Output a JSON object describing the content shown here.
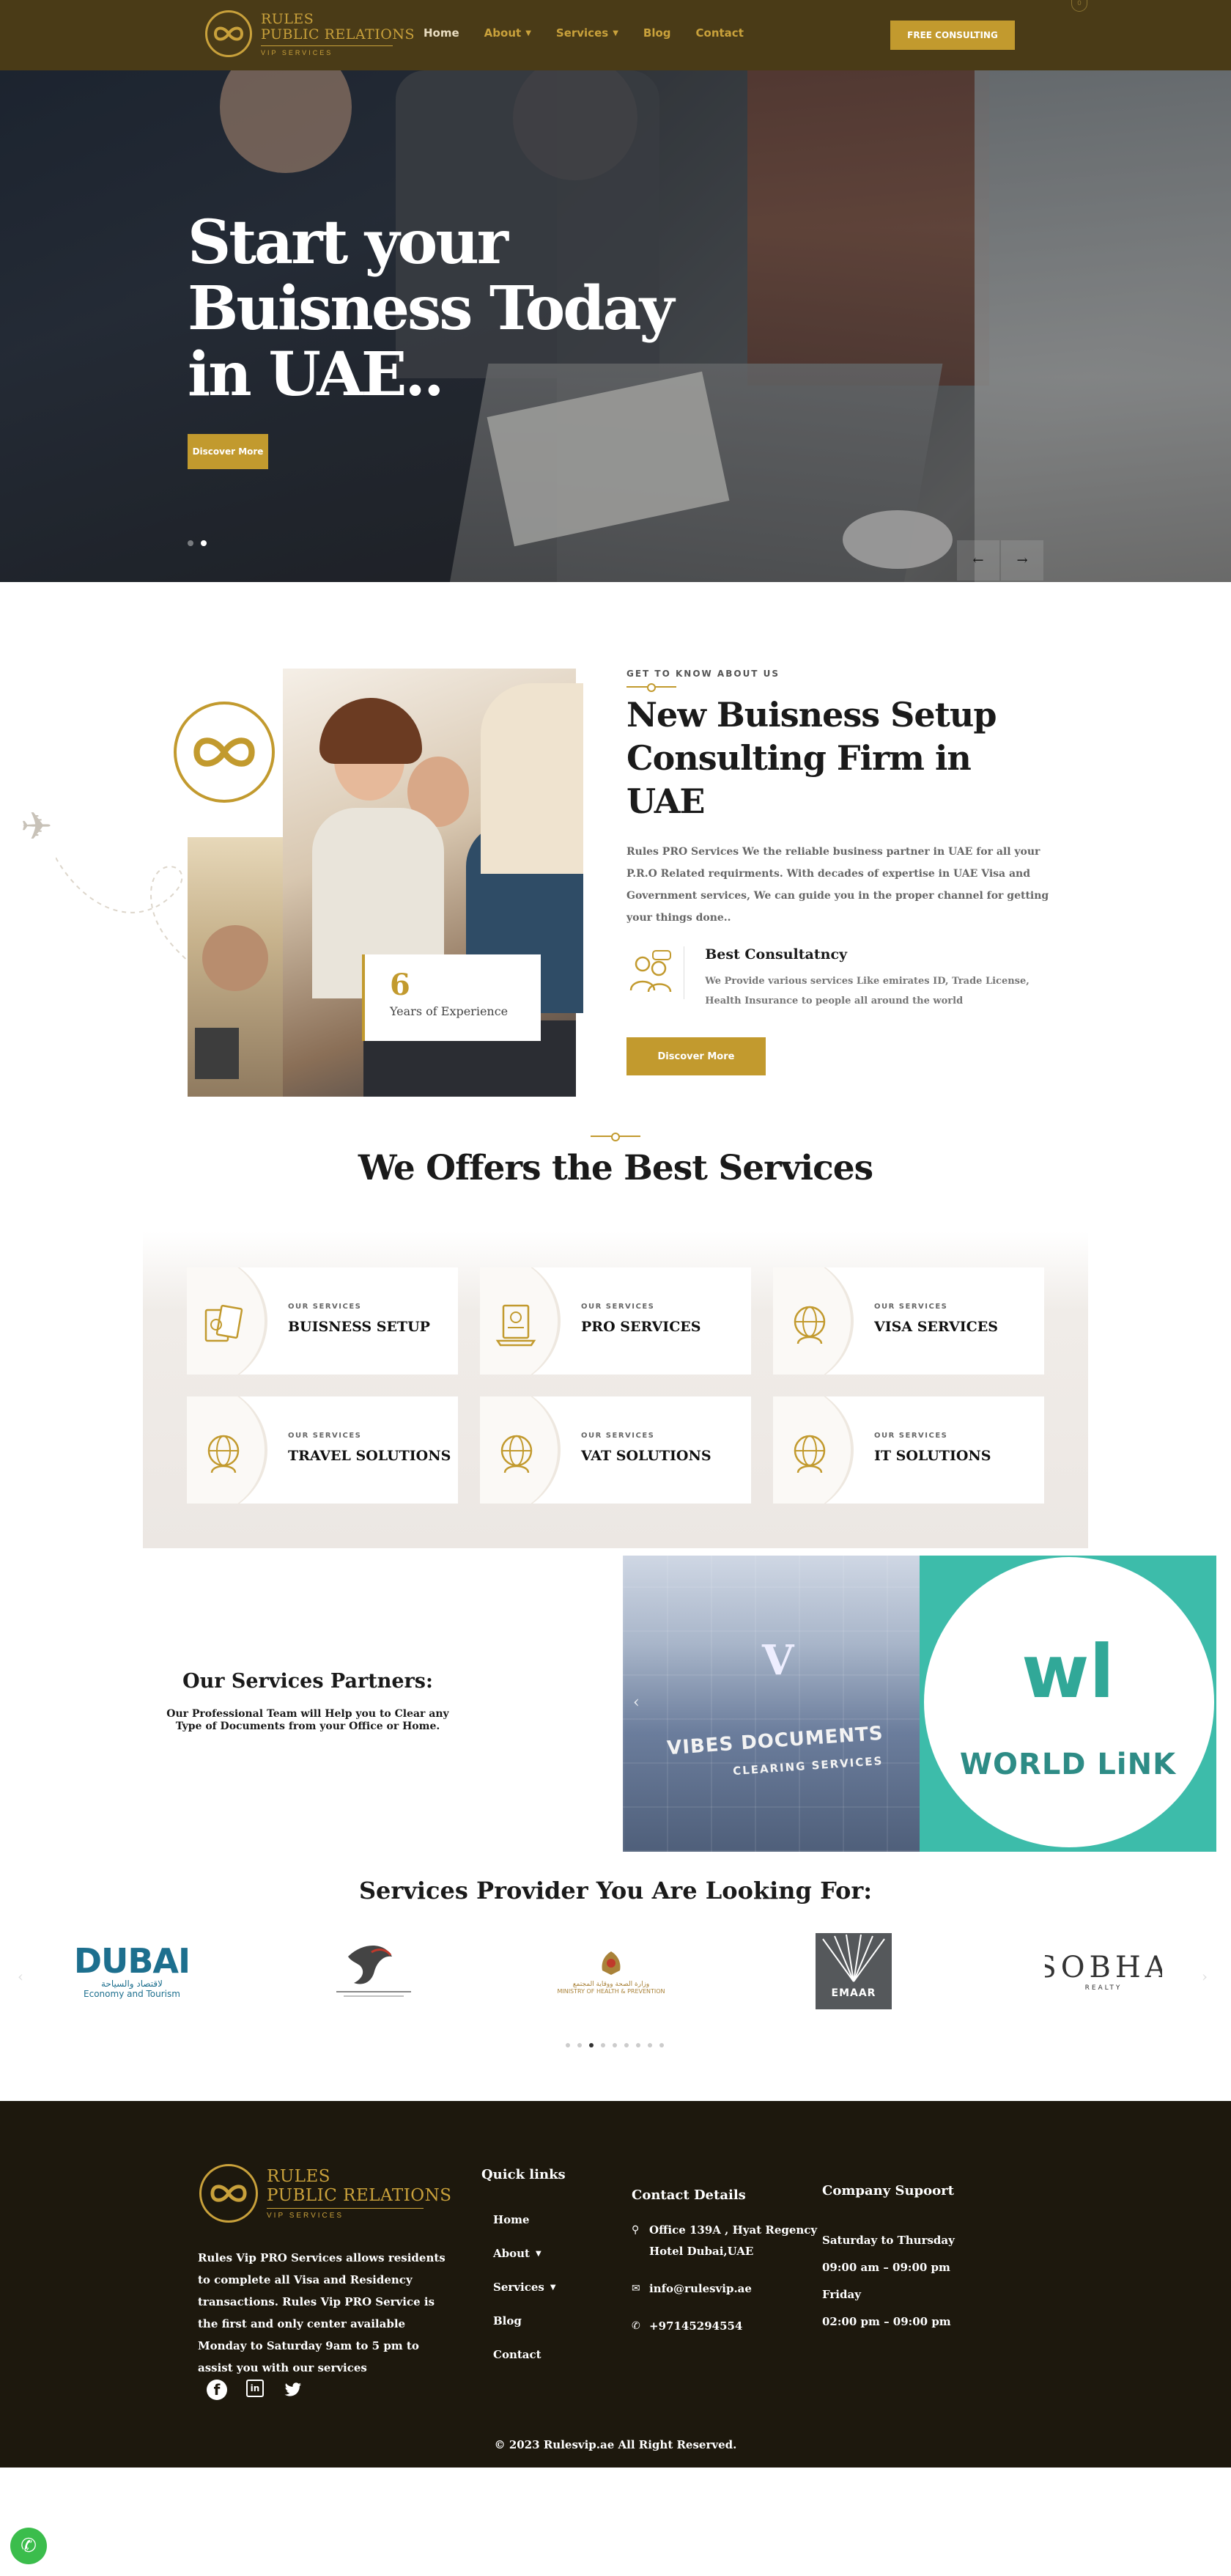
{
  "brand": {
    "line1": "RULES",
    "line2": "PUBLIC RELATIONS",
    "line3": "VIP SERVICES",
    "accent": "#c29a2e",
    "header_bg": "#4a3b17",
    "footer_bg": "#1d180d"
  },
  "nav": {
    "items": [
      {
        "label": "Home",
        "dropdown": false
      },
      {
        "label": "About",
        "dropdown": true
      },
      {
        "label": "Services",
        "dropdown": true
      },
      {
        "label": "Blog",
        "dropdown": false
      },
      {
        "label": "Contact",
        "dropdown": false
      }
    ],
    "cta": "FREE CONSULTING",
    "cart_count": "0"
  },
  "hero": {
    "title_l1": "Start your",
    "title_l2": "Buisness Today",
    "title_l3": "in UAE..",
    "button": "Discover More",
    "prev_icon": "arrow-left-icon",
    "next_icon": "arrow-right-icon"
  },
  "about": {
    "years_number": "6",
    "years_label": "Years of Experience",
    "kicker": "GET TO KNOW ABOUT US",
    "title_l1": "New Buisness Setup",
    "title_l2": "Consulting Firm in UAE",
    "description": "Rules PRO Services We the reliable business partner in UAE for all your P.R.O Related requirments. With decades of expertise in UAE Visa and Government services, We can guide you in the proper channel for getting your things done..",
    "feature_title": "Best Consultatncy",
    "feature_desc": "We Provide various services Like emirates ID, Trade License, Health Insurance to people all around the world",
    "button": "Discover More"
  },
  "services": {
    "title": "We Offers the Best Services",
    "cards": [
      {
        "kicker": "OUR SERVICES",
        "title": "BUISNESS SETUP",
        "icon": "passport-icon"
      },
      {
        "kicker": "OUR SERVICES",
        "title": "PRO SERVICES",
        "icon": "document-stamp-icon"
      },
      {
        "kicker": "OUR SERVICES",
        "title": "VISA SERVICES",
        "icon": "globe-icon"
      },
      {
        "kicker": "OUR SERVICES",
        "title": "TRAVEL SOLUTIONS",
        "icon": "globe-icon"
      },
      {
        "kicker": "OUR SERVICES",
        "title": "VAT SOLUTIONS",
        "icon": "globe-icon"
      },
      {
        "kicker": "OUR SERVICES",
        "title": "IT SOLUTIONS",
        "icon": "globe-icon"
      }
    ]
  },
  "partners": {
    "title": "Our Services Partners:",
    "subtitle": "Our Professional Team will Help you to Clear any Type of Documents from your Office or Home.",
    "slide1_sign": "VIBES DOCUMENTS",
    "slide1_sub": "CLEARING SERVICES",
    "slide1_mark": "V",
    "slide2_mark": "wl",
    "slide2_name": "WORLD LiNK"
  },
  "providers": {
    "title": "Services Provider You Are Looking For:",
    "logos": [
      {
        "name": "DUBAI",
        "sub1": "لاقتصاد والسياحة",
        "sub2": "Economy and Tourism"
      },
      {
        "name": "",
        "sub1": "",
        "sub2": ""
      },
      {
        "name": "",
        "sub1": "وزارة الصحة ووقاية المجتمع",
        "sub2": "MINISTRY OF HEALTH & PREVENTION"
      },
      {
        "name": "EMAAR",
        "sub1": "",
        "sub2": ""
      },
      {
        "name": "SOBHA",
        "sub1": "",
        "sub2": "REALTY"
      }
    ],
    "page_count": 9,
    "active_page": 3
  },
  "footer": {
    "about": "Rules Vip PRO Services allows residents to complete all Visa and Residency transactions. Rules Vip PRO Service is the first and only center available Monday to Saturday 9am to 5 pm to assist you with our services",
    "quick_links_title": "Quick links",
    "links": [
      {
        "label": "Home",
        "dropdown": false
      },
      {
        "label": "About",
        "dropdown": true
      },
      {
        "label": "Services",
        "dropdown": true
      },
      {
        "label": "Blog",
        "dropdown": false
      },
      {
        "label": "Contact",
        "dropdown": false
      }
    ],
    "contact_title": "Contact Details",
    "address": "Office 139A , Hyat Regency Hotel Dubai,UAE",
    "email": "info@rulesvip.ae",
    "phone": "+97145294554",
    "support_title": "Company Supoort",
    "hours": [
      "Saturday to Thursday",
      "09:00 am – 09:00 pm",
      "Friday",
      "02:00 pm – 09:00 pm"
    ],
    "socials": [
      "facebook-icon",
      "linkedin-icon",
      "twitter-icon"
    ],
    "copyright": "© 2023 Rulesvip.ae All Right Reserved."
  }
}
